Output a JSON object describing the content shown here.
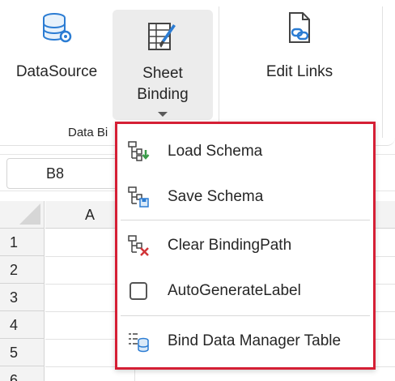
{
  "ribbon": {
    "buttons": {
      "datasource": "DataSource",
      "sheet_binding_line1": "Sheet",
      "sheet_binding_line2": "Binding",
      "edit_links": "Edit Links"
    },
    "group_label": "Data Bi"
  },
  "name_box": {
    "value": "B8"
  },
  "grid": {
    "column_headers": [
      "A"
    ],
    "row_headers": [
      "1",
      "2",
      "3",
      "4",
      "5",
      "6"
    ]
  },
  "dropdown": {
    "items": [
      {
        "label": "Load Schema",
        "icon": "load-schema-icon"
      },
      {
        "label": "Save Schema",
        "icon": "save-schema-icon"
      },
      {
        "label": "Clear BindingPath",
        "icon": "clear-bindingpath-icon"
      },
      {
        "label": "AutoGenerateLabel",
        "icon": "checkbox-unchecked",
        "checked": false
      },
      {
        "label": "Bind Data Manager Table",
        "icon": "bind-table-icon"
      }
    ],
    "highlight_color": "#d51f35"
  },
  "colors": {
    "accent_blue": "#2b7cd3",
    "accent_green": "#3a9b4a",
    "accent_red": "#d13438"
  }
}
